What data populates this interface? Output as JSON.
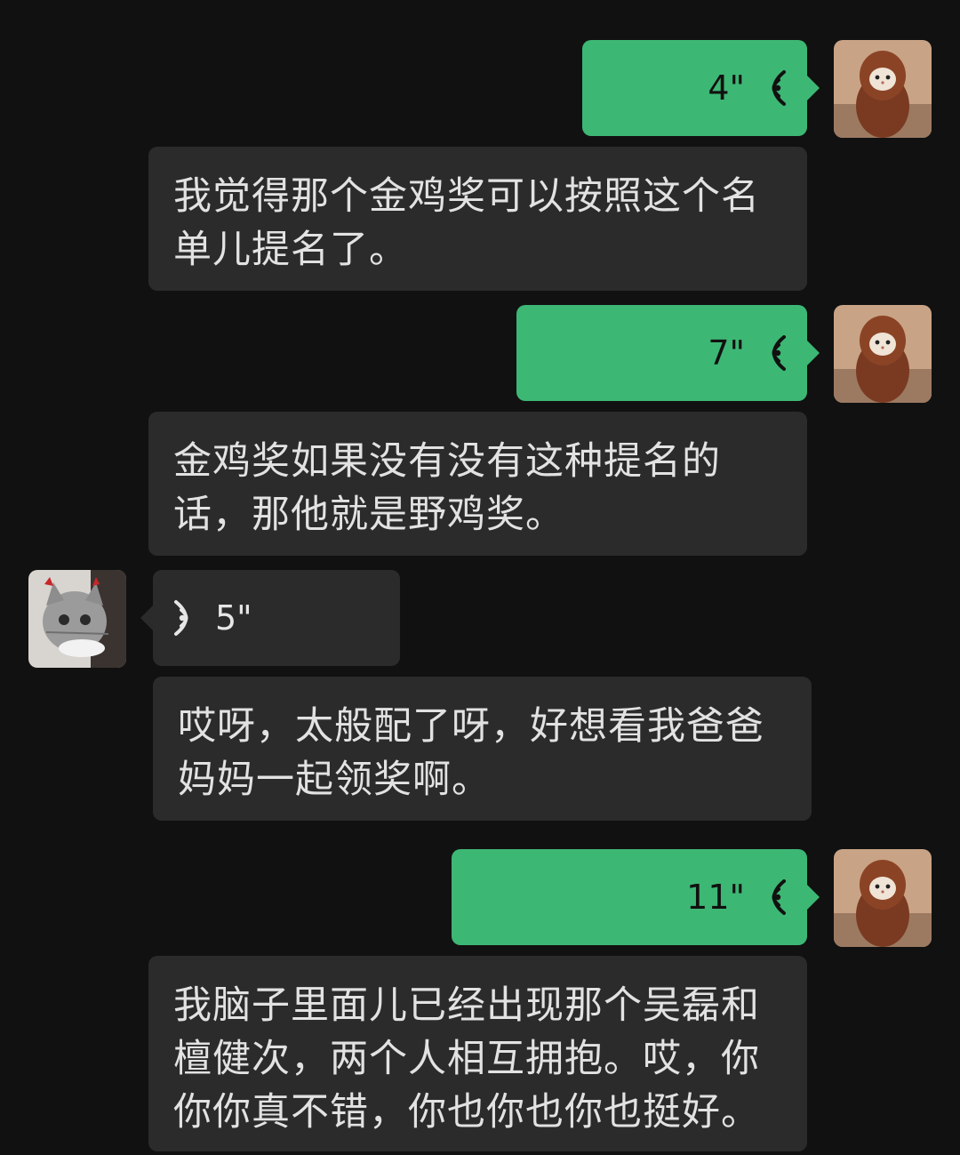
{
  "messages": [
    {
      "side": "out",
      "type": "voice",
      "duration": "4\""
    },
    {
      "side": "out",
      "type": "transcript",
      "text": "我觉得那个金鸡奖可以按照这个名单儿提名了。"
    },
    {
      "side": "out",
      "type": "voice",
      "duration": "7\""
    },
    {
      "side": "out",
      "type": "transcript",
      "text": "金鸡奖如果没有没有这种提名的话，那他就是野鸡奖。"
    },
    {
      "side": "in",
      "type": "voice",
      "duration": "5\""
    },
    {
      "side": "in",
      "type": "transcript",
      "text": "哎呀，太般配了呀，好想看我爸爸妈妈一起领奖啊。"
    },
    {
      "side": "out",
      "type": "voice",
      "duration": "11\""
    },
    {
      "side": "out",
      "type": "transcript",
      "text": "我脑子里面儿已经出现那个吴磊和檀健次，两个人相互拥抱。哎，你你你真不错，你也你也你也挺好。"
    }
  ],
  "colors": {
    "background": "#111111",
    "outgoing_bubble": "#3db774",
    "incoming_bubble": "#2b2b2b"
  },
  "icons": {
    "outgoing_voice": "voice-wave-icon",
    "incoming_voice": "voice-wave-icon",
    "my_avatar": "cat-avatar",
    "contact_avatar": "cat-avatar"
  }
}
